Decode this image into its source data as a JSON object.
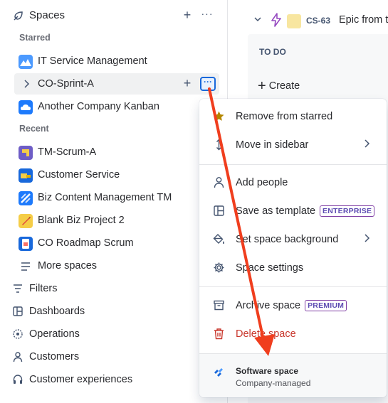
{
  "sidebar": {
    "spaces_label": "Spaces",
    "starred_label": "Starred",
    "recent_label": "Recent",
    "starred": [
      {
        "label": "IT Service Management"
      },
      {
        "label": "CO-Sprint-A"
      },
      {
        "label": "Another Company Kanban"
      }
    ],
    "recent": [
      {
        "label": "TM-Scrum-A"
      },
      {
        "label": "Customer Service"
      },
      {
        "label": "Biz Content Management TM"
      },
      {
        "label": "Blank Biz Project 2"
      },
      {
        "label": "CO Roadmap Scrum"
      }
    ],
    "more_spaces": "More spaces",
    "nav": [
      {
        "label": "Filters"
      },
      {
        "label": "Dashboards"
      },
      {
        "label": "Operations"
      },
      {
        "label": "Customers"
      },
      {
        "label": "Customer experiences"
      }
    ]
  },
  "main": {
    "issue_key": "CS-63",
    "issue_title": "Epic from t",
    "column_title": "TO DO",
    "create_label": "Create"
  },
  "menu": {
    "items": [
      {
        "label": "Remove from starred"
      },
      {
        "label": "Move in sidebar"
      },
      {
        "label": "Add people"
      },
      {
        "label": "Save as template",
        "badge": "ENTERPRISE"
      },
      {
        "label": "Set space background"
      },
      {
        "label": "Space settings"
      },
      {
        "label": "Archive space",
        "badge": "PREMIUM"
      },
      {
        "label": "Delete space"
      }
    ],
    "footer": {
      "title": "Software space",
      "subtitle": "Company-managed"
    }
  },
  "colors": {
    "accent": "#1868db",
    "danger": "#c9372c",
    "arrow": "#f03e1e",
    "star": "#b38600"
  }
}
